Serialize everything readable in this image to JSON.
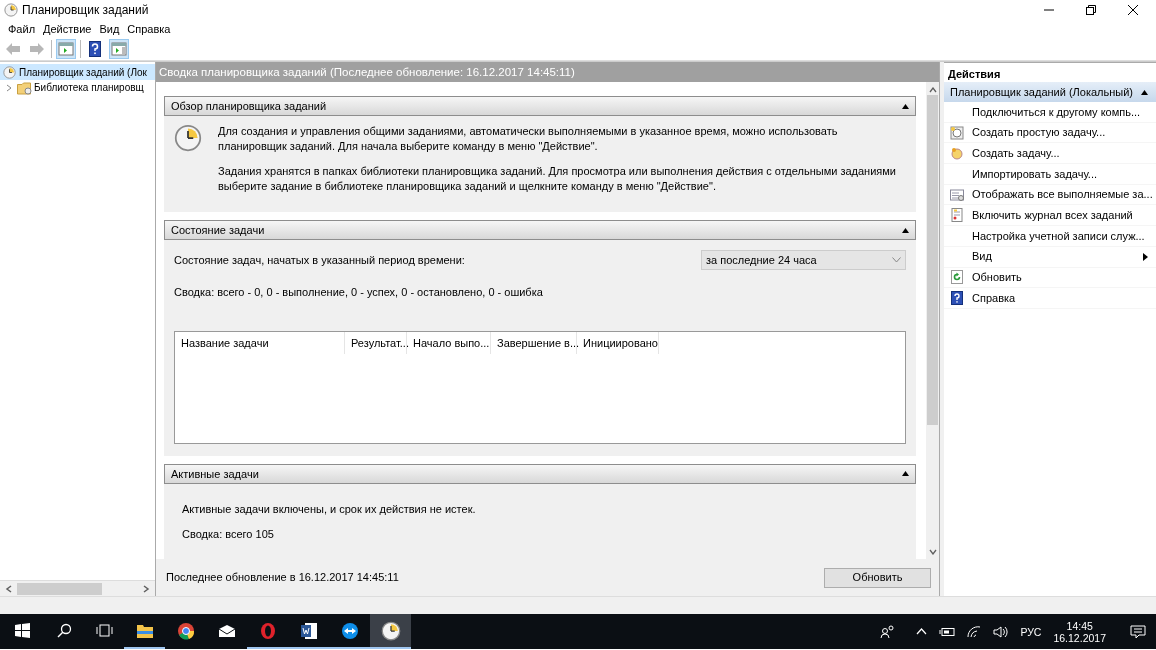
{
  "window": {
    "title": "Планировщик заданий"
  },
  "menu": [
    "Файл",
    "Действие",
    "Вид",
    "Справка"
  ],
  "toolbar": [
    {
      "kind": "back",
      "pressed": false,
      "disabled": true
    },
    {
      "kind": "forward",
      "pressed": false,
      "disabled": true
    },
    {
      "kind": "tree-pane",
      "pressed": true,
      "disabled": false
    },
    {
      "kind": "help",
      "pressed": false,
      "disabled": false
    },
    {
      "kind": "action-pane",
      "pressed": true,
      "disabled": false
    }
  ],
  "tree": [
    {
      "label": "Планировщик заданий (Лок",
      "selected": true,
      "children": [
        {
          "label": "Библиотека планировщ",
          "selected": false,
          "expanded": false
        }
      ]
    }
  ],
  "center": {
    "header": "Сводка планировщика заданий (Последнее обновление: 16.12.2017 14:45:11)",
    "sections": [
      {
        "kind": "overview",
        "title": "Обзор планировщика заданий",
        "expanded": true,
        "paragraphs": [
          "Для создания и управления общими заданиями, автоматически выполняемыми в указанное время, можно использовать планировщик заданий. Для начала выберите команду в меню \"Действие\".",
          "Задания хранятся в папках библиотеки планировщика заданий. Для просмотра или выполнения действия с отдельными заданиями выберите задание в библиотеке планировщика заданий и щелкните команду в меню \"Действие\"."
        ]
      },
      {
        "kind": "status",
        "title": "Состояние задачи",
        "expanded": true,
        "period_label": "Состояние задач, начатых в указанный период времени:",
        "period_value": "за последние 24 часа",
        "summary": "Сводка: всего - 0, 0 - выполнение, 0 - успех, 0 - остановлено, 0 - ошибка",
        "columns": [
          "Название задачи",
          "Результат...",
          "Начало выпо...",
          "Завершение в...",
          "Инициировано"
        ]
      },
      {
        "kind": "active",
        "title": "Активные задачи",
        "expanded": true,
        "paragraphs": [
          "Активные задачи включены, и срок их действия не истек.",
          "Сводка: всего 105"
        ]
      }
    ],
    "footer": "Последнее обновление в 16.12.2017 14:45:11",
    "refresh_button": "Обновить"
  },
  "actions": {
    "title": "Действия",
    "group": "Планировщик заданий (Локальный)",
    "expanded": true,
    "items": [
      {
        "kind": "plain",
        "label": "Подключиться к другому компь..."
      },
      {
        "kind": "wizard",
        "label": "Создать простую задачу..."
      },
      {
        "kind": "task",
        "label": "Создать задачу..."
      },
      {
        "kind": "plain",
        "label": "Импортировать задачу..."
      },
      {
        "kind": "list",
        "label": "Отображать все выполняемые за..."
      },
      {
        "kind": "log",
        "label": "Включить журнал всех заданий"
      },
      {
        "kind": "plain",
        "label": "Настройка учетной записи служ..."
      },
      {
        "kind": "submenu",
        "label": "Вид"
      },
      {
        "kind": "refresh",
        "label": "Обновить"
      },
      {
        "kind": "help",
        "label": "Справка"
      }
    ]
  },
  "taskbar": {
    "apps": [
      {
        "kind": "explorer",
        "running": true,
        "selected": false
      },
      {
        "kind": "browser",
        "running": false,
        "selected": false
      },
      {
        "kind": "mail",
        "running": false,
        "selected": false
      },
      {
        "kind": "opera",
        "running": true,
        "selected": false
      },
      {
        "kind": "word",
        "running": true,
        "selected": false
      },
      {
        "kind": "remote",
        "running": true,
        "selected": false
      },
      {
        "kind": "scheduler",
        "running": true,
        "selected": true
      }
    ],
    "language": "РУС",
    "time": "14:45",
    "date": "16.12.2017"
  }
}
